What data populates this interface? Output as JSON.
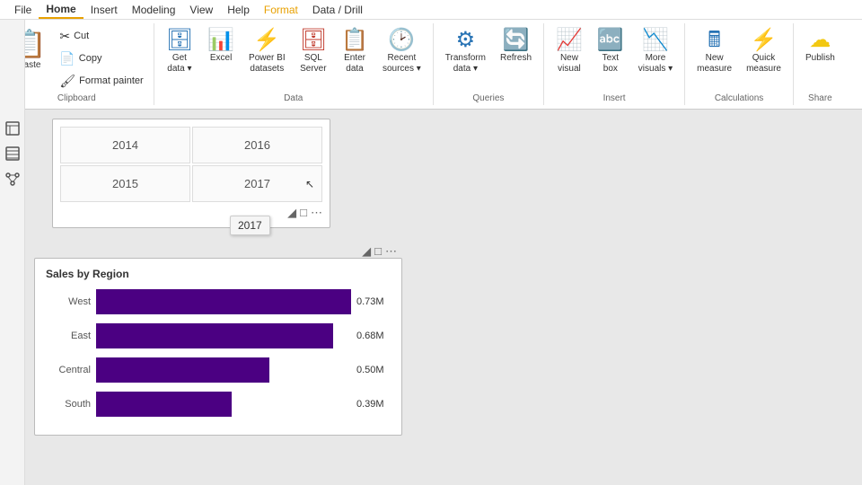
{
  "menubar": {
    "items": [
      "File",
      "Home",
      "Insert",
      "Modeling",
      "View",
      "Help",
      "Format",
      "Data / Drill"
    ],
    "active": "Home",
    "format_tab": "Format",
    "datadrill_tab": "Data / Drill"
  },
  "ribbon": {
    "groups": [
      {
        "name": "Clipboard",
        "label": "Clipboard",
        "buttons_small": [
          "Cut",
          "Copy",
          "Format painter"
        ],
        "paste_label": "Paste"
      },
      {
        "name": "Data",
        "label": "Data",
        "buttons": [
          {
            "label": "Get\ndata",
            "has_arrow": true
          },
          {
            "label": "Excel",
            "has_arrow": false
          },
          {
            "label": "Power BI\ndatasets",
            "has_arrow": false
          },
          {
            "label": "SQL\nServer",
            "has_arrow": false
          },
          {
            "label": "Enter\ndata",
            "has_arrow": false
          },
          {
            "label": "Recent\nsources",
            "has_arrow": true
          }
        ]
      },
      {
        "name": "Queries",
        "label": "Queries",
        "buttons": [
          {
            "label": "Transform\ndata",
            "has_arrow": true
          },
          {
            "label": "Refresh",
            "has_arrow": false
          }
        ]
      },
      {
        "name": "Insert",
        "label": "Insert",
        "buttons": [
          {
            "label": "New\nvisual",
            "has_arrow": false
          },
          {
            "label": "Text\nbox",
            "has_arrow": false
          },
          {
            "label": "More\nvisuals",
            "has_arrow": true
          }
        ]
      },
      {
        "name": "Calculations",
        "label": "Calculations",
        "buttons": [
          {
            "label": "New\nmeasure",
            "has_arrow": false
          },
          {
            "label": "Quick\nmeasure",
            "has_arrow": false
          }
        ]
      },
      {
        "name": "Share",
        "label": "Share",
        "buttons": [
          {
            "label": "Publish",
            "has_arrow": false
          }
        ]
      }
    ]
  },
  "slicer": {
    "cells": [
      "2014",
      "2016",
      "2015",
      "2017"
    ],
    "tooltip": "2017"
  },
  "chart": {
    "title": "Sales by Region",
    "bars": [
      {
        "label": "West",
        "value": 0.73,
        "display": "0.73M",
        "pct": 100
      },
      {
        "label": "East",
        "value": 0.68,
        "display": "0.68M",
        "pct": 93
      },
      {
        "label": "Central",
        "value": 0.5,
        "display": "0.50M",
        "pct": 68
      },
      {
        "label": "South",
        "value": 0.39,
        "display": "0.39M",
        "pct": 53
      }
    ],
    "bar_color": "#4b0082"
  },
  "sidebar": {
    "icons": [
      "report-icon",
      "data-icon",
      "model-icon"
    ]
  }
}
